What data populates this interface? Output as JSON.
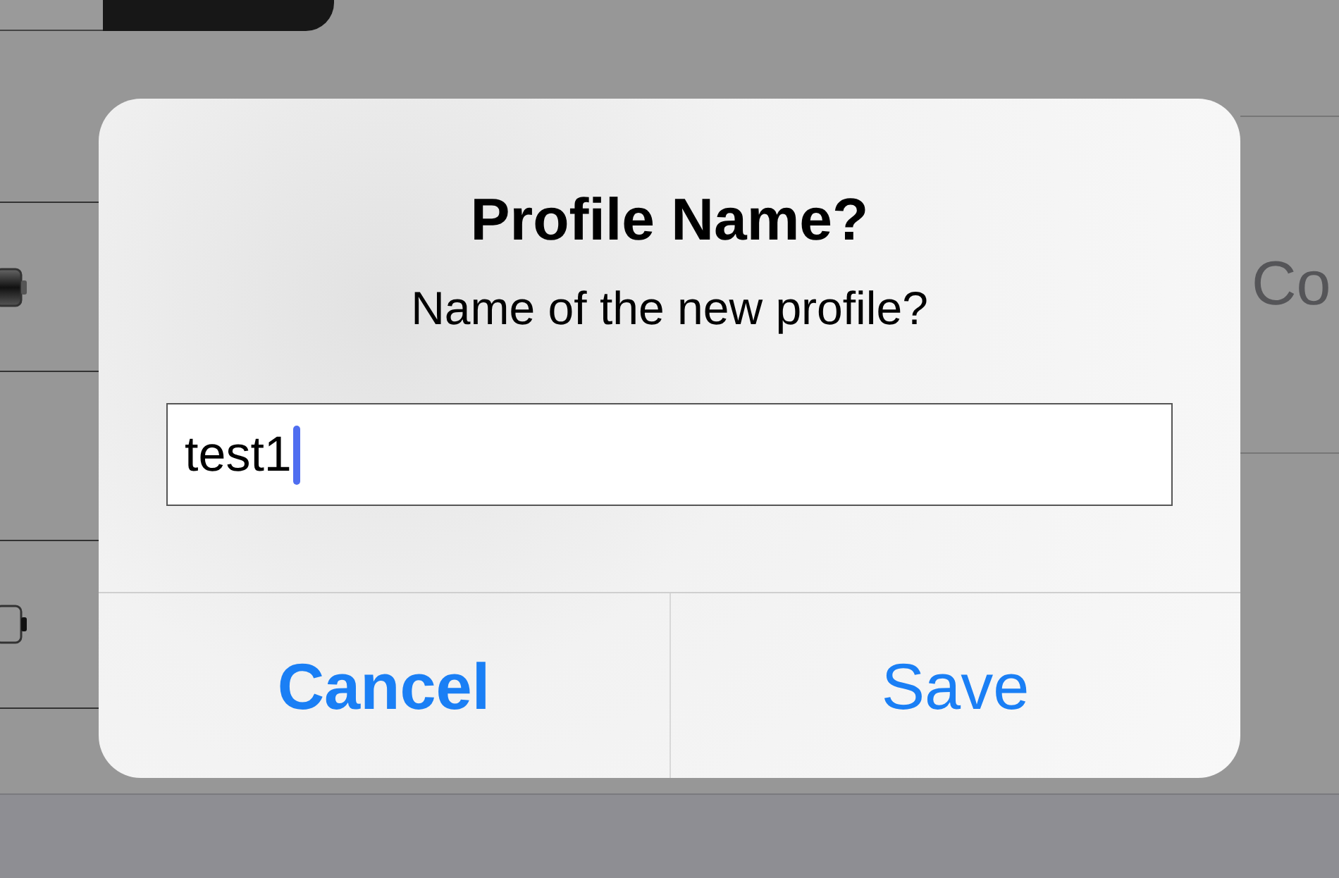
{
  "background": {
    "right_cell": {
      "label": "Co"
    }
  },
  "dialog": {
    "title": "Profile Name?",
    "message": "Name of the new profile?",
    "field": {
      "value": "test1"
    },
    "buttons": [
      {
        "label": "Cancel",
        "preferred": true
      },
      {
        "label": "Save",
        "preferred": false
      }
    ]
  }
}
